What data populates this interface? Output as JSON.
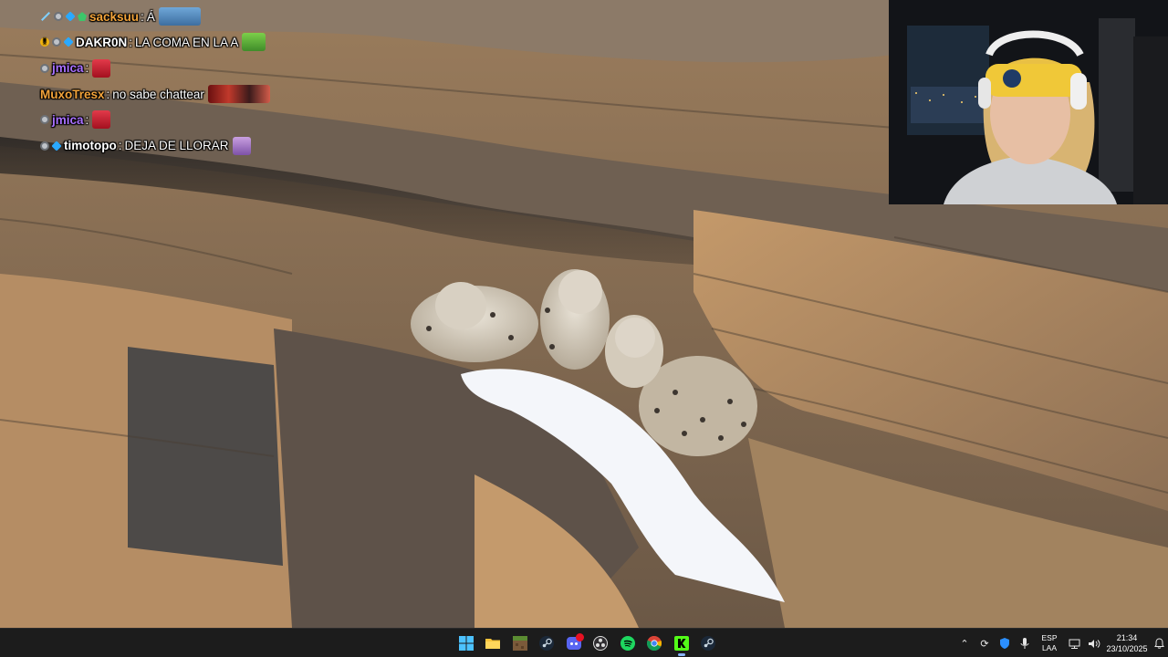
{
  "chat": {
    "messages": [
      {
        "badges": [
          "sword",
          "grey",
          "blue",
          "green"
        ],
        "user": "sacksuu",
        "user_color": "#f2a33a",
        "separator": ":",
        "text": "Á",
        "emote": "skate-emote"
      },
      {
        "badges": [
          "gold",
          "grey",
          "blue"
        ],
        "user": "DAKR0N",
        "user_color": "#ffffff",
        "separator": ":",
        "text": "LA COMA EN LA A",
        "emote": "frog-emote"
      },
      {
        "badges": [
          "grey"
        ],
        "user": "jmica",
        "user_color": "#a970ff",
        "separator": ":",
        "text": "",
        "emote": "lips-emote"
      },
      {
        "badges": [],
        "user": "MuxoTresx",
        "user_color": "#f2a33a",
        "separator": ":",
        "text": "no sabe chattear",
        "emote": "crowd-emote"
      },
      {
        "badges": [
          "grey"
        ],
        "user": "jmica",
        "user_color": "#a970ff",
        "separator": ":",
        "text": "",
        "emote": "lips-emote"
      },
      {
        "badges": [
          "grey",
          "blue"
        ],
        "user": "timotopo",
        "user_color": "#ffffff",
        "separator": ":",
        "text": "DEJA DE LLORAR",
        "emote": "cry-emote"
      }
    ]
  },
  "taskbar": {
    "apps": [
      {
        "name": "start-button",
        "icon": "windows-icon",
        "active": false
      },
      {
        "name": "file-explorer",
        "icon": "folder-icon",
        "active": false
      },
      {
        "name": "minecraft",
        "icon": "minecraft-icon",
        "active": false
      },
      {
        "name": "steam",
        "icon": "steam-icon",
        "active": false
      },
      {
        "name": "discord",
        "icon": "discord-icon",
        "active": false,
        "badge": "99+"
      },
      {
        "name": "obs",
        "icon": "obs-icon",
        "active": false
      },
      {
        "name": "spotify",
        "icon": "spotify-icon",
        "active": false
      },
      {
        "name": "chrome",
        "icon": "chrome-icon",
        "active": false
      },
      {
        "name": "kick",
        "icon": "kick-icon",
        "active": true
      },
      {
        "name": "steam-2",
        "icon": "steam-icon",
        "active": false
      }
    ],
    "tray": {
      "lang_top": "ESP",
      "lang_bottom": "LAA",
      "time": "21:34",
      "date": "23/10/2025"
    }
  },
  "colors": {
    "taskbar_bg": "#1c1c1c",
    "kick_green": "#53fc18",
    "spotify_green": "#1ed760",
    "steam_blue": "#1b2838",
    "discord_blurple": "#5865f2"
  }
}
